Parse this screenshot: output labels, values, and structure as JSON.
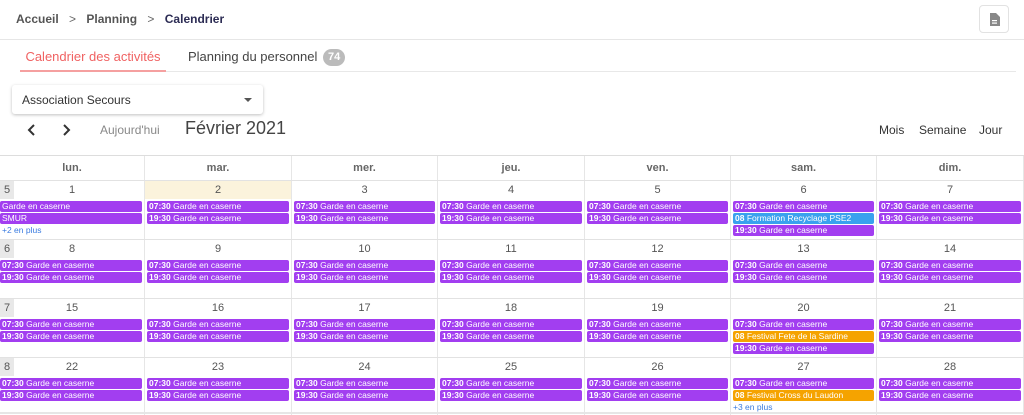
{
  "breadcrumb": {
    "home": "Accueil",
    "sep": ">",
    "section": "Planning",
    "current": "Calendrier"
  },
  "tabs": {
    "activities": "Calendrier des activités",
    "staff": "Planning du personnel",
    "staff_count": "74"
  },
  "select": {
    "value": "Association Secours"
  },
  "toolbar": {
    "today": "Aujourd'hui",
    "title": "Février 2021",
    "month": "Mois",
    "week": "Semaine",
    "day": "Jour"
  },
  "days_of_week": [
    "lun.",
    "mar.",
    "mer.",
    "jeu.",
    "ven.",
    "sam.",
    "dim."
  ],
  "colors": {
    "event_purple": "#a23ef0",
    "event_blue": "#3aa1ee",
    "event_orange": "#f5a300",
    "today_bg": "#fbf3dc",
    "active_tab": "#f06262"
  },
  "weeks": [
    {
      "num": "5",
      "days": [
        {
          "date": "1",
          "events": [
            {
              "time": "",
              "title": "Garde en caserne"
            },
            {
              "time": "",
              "title": "SMUR"
            }
          ],
          "more": "+2 en plus"
        },
        {
          "date": "2",
          "today": true,
          "events": [
            {
              "time": "07:30",
              "title": "Garde en caserne"
            },
            {
              "time": "19:30",
              "title": "Garde en caserne"
            }
          ]
        },
        {
          "date": "3",
          "events": [
            {
              "time": "07:30",
              "title": "Garde en caserne"
            },
            {
              "time": "19:30",
              "title": "Garde en caserne"
            }
          ]
        },
        {
          "date": "4",
          "events": [
            {
              "time": "07:30",
              "title": "Garde en caserne"
            },
            {
              "time": "19:30",
              "title": "Garde en caserne"
            }
          ]
        },
        {
          "date": "5",
          "events": [
            {
              "time": "07:30",
              "title": "Garde en caserne"
            },
            {
              "time": "19:30",
              "title": "Garde en caserne"
            }
          ]
        },
        {
          "date": "6",
          "events": [
            {
              "time": "07:30",
              "title": "Garde en caserne"
            },
            {
              "time": "08",
              "title": "Formation Recyclage PSE2",
              "color": "blue"
            },
            {
              "time": "19:30",
              "title": "Garde en caserne"
            }
          ]
        },
        {
          "date": "7",
          "events": [
            {
              "time": "07:30",
              "title": "Garde en caserne"
            },
            {
              "time": "19:30",
              "title": "Garde en caserne"
            }
          ]
        }
      ]
    },
    {
      "num": "6",
      "days": [
        {
          "date": "8",
          "events": [
            {
              "time": "07:30",
              "title": "Garde en caserne"
            },
            {
              "time": "19:30",
              "title": "Garde en caserne"
            }
          ]
        },
        {
          "date": "9",
          "events": [
            {
              "time": "07:30",
              "title": "Garde en caserne"
            },
            {
              "time": "19:30",
              "title": "Garde en caserne"
            }
          ]
        },
        {
          "date": "10",
          "events": [
            {
              "time": "07:30",
              "title": "Garde en caserne"
            },
            {
              "time": "19:30",
              "title": "Garde en caserne"
            }
          ]
        },
        {
          "date": "11",
          "events": [
            {
              "time": "07:30",
              "title": "Garde en caserne"
            },
            {
              "time": "19:30",
              "title": "Garde en caserne"
            }
          ]
        },
        {
          "date": "12",
          "events": [
            {
              "time": "07:30",
              "title": "Garde en caserne"
            },
            {
              "time": "19:30",
              "title": "Garde en caserne"
            }
          ]
        },
        {
          "date": "13",
          "events": [
            {
              "time": "07:30",
              "title": "Garde en caserne"
            },
            {
              "time": "19:30",
              "title": "Garde en caserne"
            }
          ]
        },
        {
          "date": "14",
          "events": [
            {
              "time": "07:30",
              "title": "Garde en caserne"
            },
            {
              "time": "19:30",
              "title": "Garde en caserne"
            }
          ]
        }
      ]
    },
    {
      "num": "7",
      "days": [
        {
          "date": "15",
          "events": [
            {
              "time": "07:30",
              "title": "Garde en caserne"
            },
            {
              "time": "19:30",
              "title": "Garde en caserne"
            }
          ]
        },
        {
          "date": "16",
          "events": [
            {
              "time": "07:30",
              "title": "Garde en caserne"
            },
            {
              "time": "19:30",
              "title": "Garde en caserne"
            }
          ]
        },
        {
          "date": "17",
          "events": [
            {
              "time": "07:30",
              "title": "Garde en caserne"
            },
            {
              "time": "19:30",
              "title": "Garde en caserne"
            }
          ]
        },
        {
          "date": "18",
          "events": [
            {
              "time": "07:30",
              "title": "Garde en caserne"
            },
            {
              "time": "19:30",
              "title": "Garde en caserne"
            }
          ]
        },
        {
          "date": "19",
          "events": [
            {
              "time": "07:30",
              "title": "Garde en caserne"
            },
            {
              "time": "19:30",
              "title": "Garde en caserne"
            }
          ]
        },
        {
          "date": "20",
          "events": [
            {
              "time": "07:30",
              "title": "Garde en caserne"
            },
            {
              "time": "08",
              "title": "Festival Fete de la Sardine",
              "color": "orange"
            },
            {
              "time": "19:30",
              "title": "Garde en caserne"
            }
          ]
        },
        {
          "date": "21",
          "events": [
            {
              "time": "07:30",
              "title": "Garde en caserne"
            },
            {
              "time": "19:30",
              "title": "Garde en caserne"
            }
          ]
        }
      ]
    },
    {
      "num": "8",
      "days": [
        {
          "date": "22",
          "events": [
            {
              "time": "07:30",
              "title": "Garde en caserne"
            },
            {
              "time": "19:30",
              "title": "Garde en caserne"
            }
          ]
        },
        {
          "date": "23",
          "events": [
            {
              "time": "07:30",
              "title": "Garde en caserne"
            },
            {
              "time": "19:30",
              "title": "Garde en caserne"
            }
          ]
        },
        {
          "date": "24",
          "events": [
            {
              "time": "07:30",
              "title": "Garde en caserne"
            },
            {
              "time": "19:30",
              "title": "Garde en caserne"
            }
          ]
        },
        {
          "date": "25",
          "events": [
            {
              "time": "07:30",
              "title": "Garde en caserne"
            },
            {
              "time": "19:30",
              "title": "Garde en caserne"
            }
          ]
        },
        {
          "date": "26",
          "events": [
            {
              "time": "07:30",
              "title": "Garde en caserne"
            },
            {
              "time": "19:30",
              "title": "Garde en caserne"
            }
          ]
        },
        {
          "date": "27",
          "events": [
            {
              "time": "07:30",
              "title": "Garde en caserne"
            },
            {
              "time": "08",
              "title": "Festival Cross du Laudon",
              "color": "orange"
            }
          ],
          "more": "+3 en plus"
        },
        {
          "date": "28",
          "events": [
            {
              "time": "07:30",
              "title": "Garde en caserne"
            },
            {
              "time": "19:30",
              "title": "Garde en caserne"
            }
          ]
        }
      ]
    }
  ]
}
